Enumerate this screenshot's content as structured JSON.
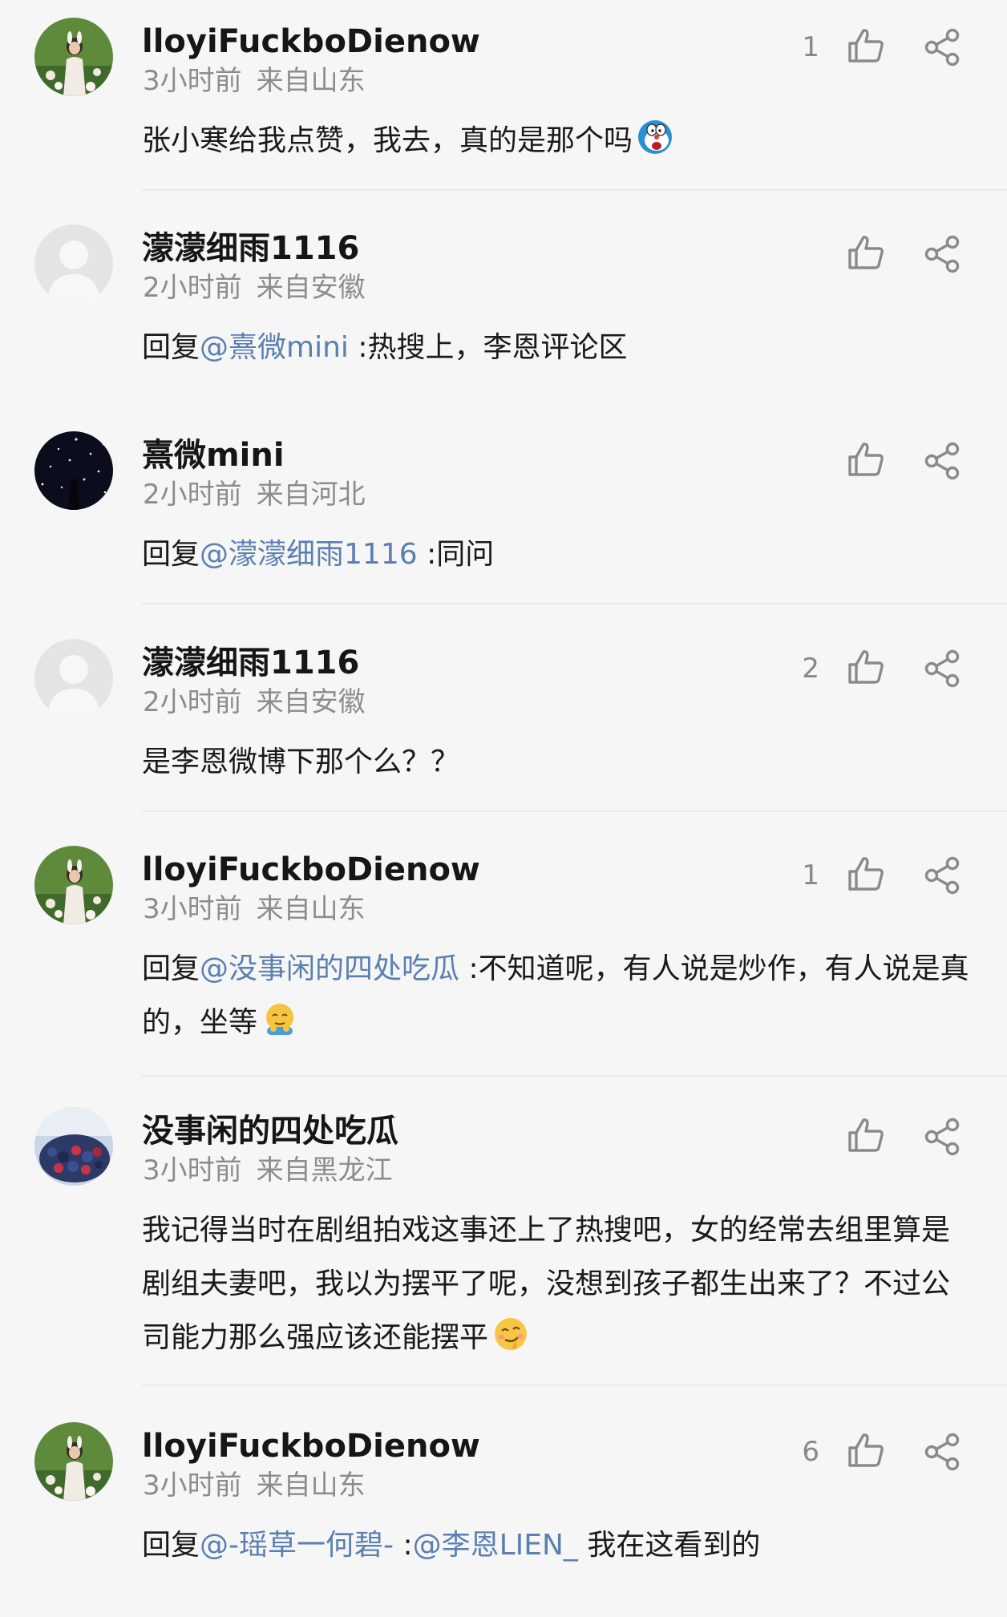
{
  "comments": [
    {
      "username": "lloyiFuckboDienow",
      "time": "3小时前",
      "location": "来自山东",
      "like_count": "1",
      "avatar": "girl-with-flowers",
      "parts": [
        {
          "text": "张小寒给我点赞，我去，真的是那个吗"
        }
      ],
      "emoji": "doraemon-shocked-emoji"
    },
    {
      "username": "濛濛细雨1116",
      "time": "2小时前",
      "location": "来自安徽",
      "like_count": "",
      "avatar": "default-gray",
      "parts": [
        {
          "text": "回复"
        },
        {
          "text": "@熹微mini",
          "mention": true
        },
        {
          "text": " :热搜上，李恩评论区"
        }
      ]
    },
    {
      "username": "熹微mini",
      "time": "2小时前",
      "location": "来自河北",
      "like_count": "",
      "avatar": "starry-night",
      "parts": [
        {
          "text": "回复"
        },
        {
          "text": "@濛濛细雨1116",
          "mention": true
        },
        {
          "text": " :同问"
        }
      ]
    },
    {
      "username": "濛濛细雨1116",
      "time": "2小时前",
      "location": "来自安徽",
      "like_count": "2",
      "avatar": "default-gray",
      "parts": [
        {
          "text": "是李恩微博下那个么？？"
        }
      ]
    },
    {
      "username": "lloyiFuckboDienow",
      "time": "3小时前",
      "location": "来自山东",
      "like_count": "1",
      "avatar": "girl-with-flowers",
      "parts": [
        {
          "text": "回复"
        },
        {
          "text": "@没事闲的四处吃瓜",
          "mention": true
        },
        {
          "text": " :不知道呢，有人说是炒作，有人说是真的，坐等"
        }
      ],
      "emoji": "waiting-emoji"
    },
    {
      "username": "没事闲的四处吃瓜",
      "time": "3小时前",
      "location": "来自黑龙江",
      "like_count": "",
      "avatar": "berries",
      "parts": [
        {
          "text": "我记得当时在剧组拍戏这事还上了热搜吧，女的经常去组里算是剧组夫妻吧，我以为摆平了呢，没想到孩子都生出来了？不过公司能力那么强应该还能摆平"
        }
      ],
      "emoji": "smirk-emoji"
    },
    {
      "username": "lloyiFuckboDienow",
      "time": "3小时前",
      "location": "来自山东",
      "like_count": "6",
      "avatar": "girl-with-flowers",
      "parts": [
        {
          "text": "回复"
        },
        {
          "text": "@-瑶草一何碧-",
          "mention": true
        },
        {
          "text": " :"
        },
        {
          "text": "@李恩LIEN_",
          "mention": true
        },
        {
          "text": " 我在这看到的"
        }
      ]
    }
  ],
  "icons": {
    "like": "thumbs-up-icon",
    "share": "share-icon"
  },
  "colors": {
    "mention": "#5a7fb0",
    "meta": "#8c8c8c",
    "background": "#f6f6f6"
  }
}
